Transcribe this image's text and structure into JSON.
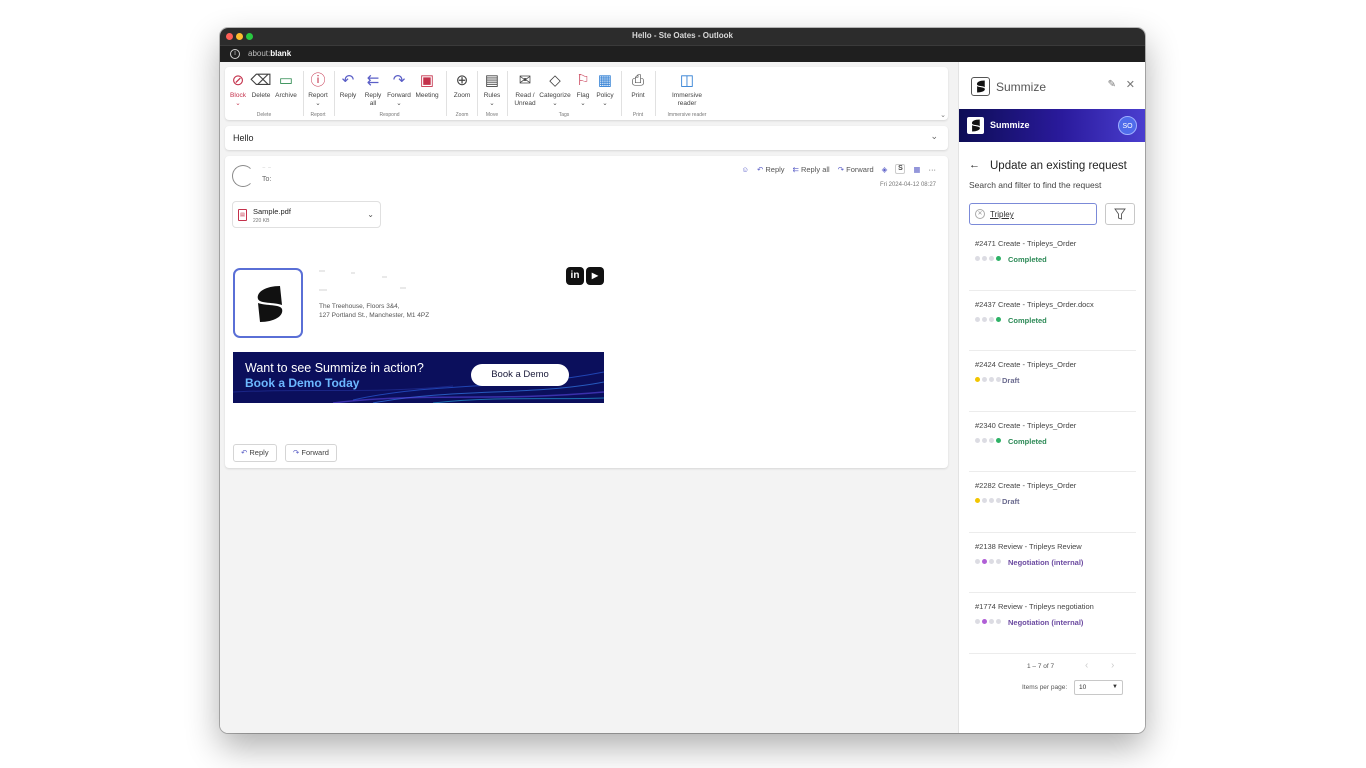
{
  "window": {
    "title": "Hello - Ste Oates - Outlook",
    "url_prefix": "about:",
    "url_bold": "blank"
  },
  "ribbon": {
    "buttons": [
      {
        "label": "Block",
        "icon": "block-icon",
        "glyph": "⊘"
      },
      {
        "label": "Delete",
        "icon": "trash-icon",
        "glyph": "🗑"
      },
      {
        "label": "Archive",
        "icon": "archive-icon",
        "glyph": "▭"
      },
      {
        "label": "Report",
        "icon": "report-icon",
        "glyph": "ⓘ"
      },
      {
        "label": "Reply",
        "icon": "reply-icon",
        "glyph": "↶"
      },
      {
        "label": "Reply all",
        "icon": "reply-all-icon",
        "glyph": "↶"
      },
      {
        "label": "Forward",
        "icon": "forward-icon",
        "glyph": "↷"
      },
      {
        "label": "Meeting",
        "icon": "meeting-icon",
        "glyph": "▣"
      },
      {
        "label": "Zoom",
        "icon": "zoom-icon",
        "glyph": "⊕"
      },
      {
        "label": "Rules",
        "icon": "rules-icon",
        "glyph": "▤"
      },
      {
        "label": "Read / Unread",
        "icon": "envelope-icon",
        "glyph": "✉"
      },
      {
        "label": "Categorize",
        "icon": "tag-icon",
        "glyph": "◇"
      },
      {
        "label": "Flag",
        "icon": "flag-icon",
        "glyph": "⚑"
      },
      {
        "label": "Policy",
        "icon": "policy-icon",
        "glyph": "▦"
      },
      {
        "label": "Print",
        "icon": "printer-icon",
        "glyph": "⎙"
      },
      {
        "label": "Immersive reader",
        "icon": "immersive-reader-icon",
        "glyph": "◫"
      }
    ],
    "groups": [
      "Delete",
      "Report",
      "Respond",
      "Zoom",
      "Move",
      "Tags",
      "Print",
      "Immersive reader"
    ]
  },
  "message": {
    "subject": "Hello",
    "to_label": "To:",
    "actions": {
      "reply": "Reply",
      "reply_all": "Reply all",
      "forward": "Forward"
    },
    "date": "Fri 2024-04-12 08:27",
    "attachment": {
      "name": "Sample.pdf",
      "size": "220 KB"
    },
    "signature_address_1": "The Treehouse, Floors 3&4,",
    "signature_address_2": "127 Portland St., Manchester, M1 4PZ",
    "social": {
      "linkedin": "in",
      "youtube": "▶"
    },
    "banner": {
      "line1": "Want to see Summize in action?",
      "line2": "Book a Demo Today",
      "cta": "Book a Demo"
    },
    "footer": {
      "reply": "Reply",
      "forward": "Forward"
    }
  },
  "panel": {
    "app_name": "Summize",
    "bar_name": "Summize",
    "avatar_initials": "SO",
    "heading": "Update an existing request",
    "subheading": "Search and filter to find the request",
    "search_value": "Tripley",
    "items": [
      {
        "title": "#2471 Create - Tripleys_Order",
        "status": "Completed",
        "dots": [
          "#dcdce3",
          "#dcdce3",
          "#dcdce3",
          "#2db266"
        ]
      },
      {
        "title": "#2437 Create - Tripleys_Order.docx",
        "status": "Completed",
        "dots": [
          "#dcdce3",
          "#dcdce3",
          "#dcdce3",
          "#2db266"
        ]
      },
      {
        "title": "#2424 Create - Tripleys_Order",
        "status": "Draft",
        "dots": [
          "#f2c500",
          "#dcdce3",
          "#dcdce3",
          "#dcdce3"
        ]
      },
      {
        "title": "#2340 Create - Tripleys_Order",
        "status": "Completed",
        "dots": [
          "#dcdce3",
          "#dcdce3",
          "#dcdce3",
          "#2db266"
        ]
      },
      {
        "title": "#2282 Create - Tripleys_Order",
        "status": "Draft",
        "dots": [
          "#f2c500",
          "#dcdce3",
          "#dcdce3",
          "#dcdce3"
        ]
      },
      {
        "title": "#2138 Review - Tripleys Review",
        "status": "Negotiation (internal)",
        "dots": [
          "#dcdce3",
          "#b05fd6",
          "#dcdce3",
          "#dcdce3"
        ]
      },
      {
        "title": "#1774 Review - Tripleys negotiation",
        "status": "Negotiation (internal)",
        "dots": [
          "#dcdce3",
          "#b05fd6",
          "#dcdce3",
          "#dcdce3"
        ]
      }
    ],
    "pager": "1 – 7 of 7",
    "items_per_page_label": "Items per page:",
    "items_per_page_value": "10"
  }
}
